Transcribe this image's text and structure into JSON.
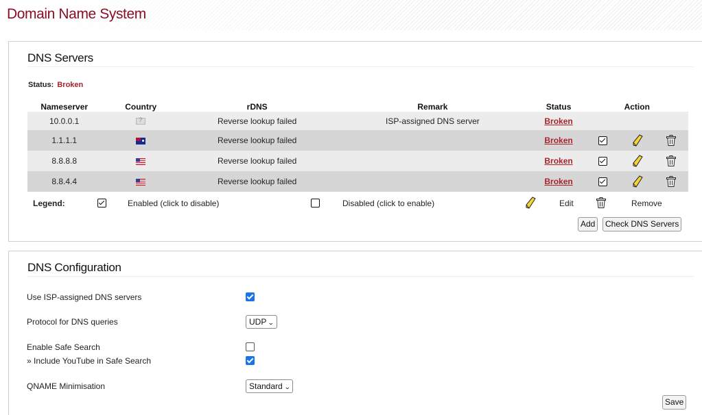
{
  "page": {
    "title": "Domain Name System"
  },
  "servers_panel": {
    "title": "DNS Servers",
    "status_label": "Status:",
    "status_value": "Broken",
    "columns": [
      "Nameserver",
      "Country",
      "rDNS",
      "Remark",
      "Status",
      "Action"
    ],
    "rows": [
      {
        "nameserver": "10.0.0.1",
        "flag": "unknown-flag-icon",
        "rdns": "Reverse lookup failed",
        "remark": "ISP-assigned DNS server",
        "status": "Broken",
        "has_actions": false
      },
      {
        "nameserver": "1.1.1.1",
        "flag": "australia-flag-icon",
        "rdns": "Reverse lookup failed",
        "remark": "",
        "status": "Broken",
        "has_actions": true,
        "enabled": true
      },
      {
        "nameserver": "8.8.8.8",
        "flag": "usa-flag-icon",
        "rdns": "Reverse lookup failed",
        "remark": "",
        "status": "Broken",
        "has_actions": true,
        "enabled": true
      },
      {
        "nameserver": "8.8.4.4",
        "flag": "usa-flag-icon",
        "rdns": "Reverse lookup failed",
        "remark": "",
        "status": "Broken",
        "has_actions": true,
        "enabled": true
      }
    ],
    "legend": {
      "label": "Legend:",
      "enabled": "Enabled (click to disable)",
      "disabled": "Disabled (click to enable)",
      "edit": "Edit",
      "remove": "Remove"
    },
    "add_button": "Add",
    "check_button": "Check DNS Servers"
  },
  "config_panel": {
    "title": "DNS Configuration",
    "use_isp_label": "Use ISP-assigned DNS servers",
    "use_isp_checked": true,
    "protocol_label": "Protocol for DNS queries",
    "protocol_value": "UDP",
    "safe_search_label": "Enable Safe Search",
    "safe_search_checked": false,
    "youtube_label": "» Include YouTube in Safe Search",
    "youtube_checked": true,
    "qname_label": "QNAME Minimisation",
    "qname_value": "Standard",
    "save_button": "Save"
  },
  "colors": {
    "title": "#8b0e24",
    "status": "#a8242b",
    "checkbox": "#1a73e8",
    "row_odd": "#ececec",
    "row_even": "#d6d6d6"
  }
}
